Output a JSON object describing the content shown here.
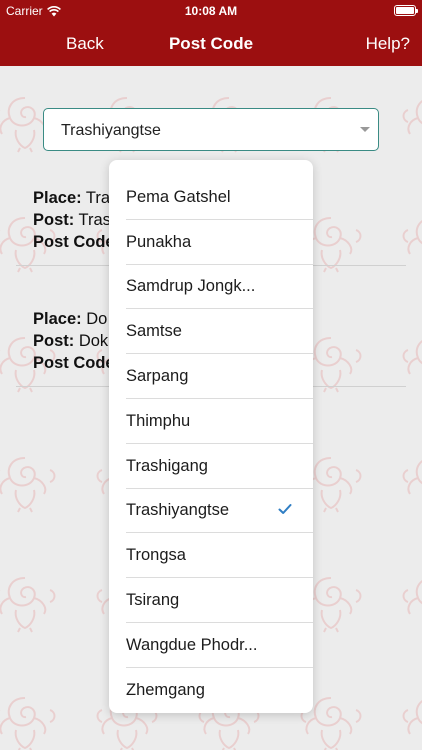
{
  "status_bar": {
    "carrier": "Carrier",
    "time": "10:08 AM"
  },
  "nav": {
    "back_label": "Back",
    "title": "Post Code",
    "help_label": "Help?"
  },
  "district_select": {
    "value": "Trashiyangtse"
  },
  "results": [
    {
      "place_label": "Place:",
      "place_value": "Tra",
      "post_label": "Post:",
      "post_value": "Tras",
      "code_label": "Post Code:"
    },
    {
      "place_label": "Place:",
      "place_value": "Do",
      "post_label": "Post:",
      "post_value": "Dok",
      "code_label": "Post Code:"
    }
  ],
  "dropdown": {
    "items": [
      {
        "label": "Pema Gatshel",
        "selected": false
      },
      {
        "label": "Punakha",
        "selected": false
      },
      {
        "label": "Samdrup Jongk...",
        "selected": false
      },
      {
        "label": "Samtse",
        "selected": false
      },
      {
        "label": "Sarpang",
        "selected": false
      },
      {
        "label": "Thimphu",
        "selected": false
      },
      {
        "label": "Trashigang",
        "selected": false
      },
      {
        "label": "Trashiyangtse",
        "selected": true
      },
      {
        "label": "Trongsa",
        "selected": false
      },
      {
        "label": "Tsirang",
        "selected": false
      },
      {
        "label": "Wangdue Phodr...",
        "selected": false
      },
      {
        "label": "Zhemgang",
        "selected": false
      }
    ]
  },
  "colors": {
    "brand_red": "#9c0f10",
    "select_border": "#3a8b84",
    "check_blue": "#2f7ec4",
    "motif": "#e8b9b9"
  },
  "icons": {
    "wifi": "wifi-icon",
    "battery": "battery-icon",
    "check": "checkmark-icon",
    "dropdown_arrow": "chevron-down-icon",
    "background": "conch-shell-motif"
  }
}
